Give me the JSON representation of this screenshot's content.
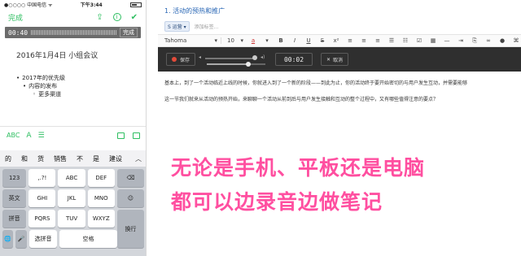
{
  "phone": {
    "status": {
      "carrier": "●○○○○ 中国电信 ᯤ",
      "time": "下午3:44"
    },
    "nav": {
      "done": "完成",
      "share_icon": "share-icon",
      "info_icon": "info-icon",
      "check_icon": "check-icon"
    },
    "recorder": {
      "time": "00:40",
      "done": "完成"
    },
    "note_title": "2016年1月4日 小组会议",
    "outline": [
      {
        "level": 1,
        "text": "2017年的优先级"
      },
      {
        "level": 2,
        "text": "内容的发布"
      },
      {
        "level": 3,
        "text": "更多渠道"
      }
    ],
    "format_bar": {
      "abc": "ABC",
      "font": "A",
      "list": "☰"
    },
    "candidates": [
      "的",
      "和",
      "货",
      "销售",
      "不",
      "是",
      "建设"
    ],
    "keyboard": {
      "left": [
        "123",
        "英文",
        "拼音",
        ""
      ],
      "rows": [
        [
          ",.?!",
          "ABC",
          "DEF"
        ],
        [
          "GHI",
          "JKL",
          "MNO"
        ],
        [
          "PQRS",
          "TUV",
          "WXYZ"
        ]
      ],
      "right": [
        "⌫",
        "☺",
        "换行"
      ],
      "bottom": {
        "globe": "🌐",
        "mic": "🎤",
        "select_pinyin": "选拼音",
        "space": "空格"
      }
    }
  },
  "editor": {
    "title": "1. 活动的预热和推广",
    "tag": "S 运营 ▾",
    "tag_placeholder": "添加标签...",
    "toolbar": {
      "font": "Tahoma",
      "size": "10"
    },
    "audio": {
      "record": "保存",
      "time": "00:02",
      "cancel": "取消"
    },
    "body_line_1": "基本上，到了一个活动临近上线的时候，你就进入到了一个新的阶段——到此为止，你的活动终于要开始密切的与用户发生互动，并需要能够",
    "body_line_2": "这一节我们就来从活动的预热开始，来聊聊一个活动从前到后与用户发生接触和互动的整个过程中，又有哪些值得注意的要点？"
  },
  "overlay": {
    "line1": "无论是手机、平板还是电脑",
    "line2": "都可以边录音边做笔记",
    "color": "#ff4fa0"
  }
}
